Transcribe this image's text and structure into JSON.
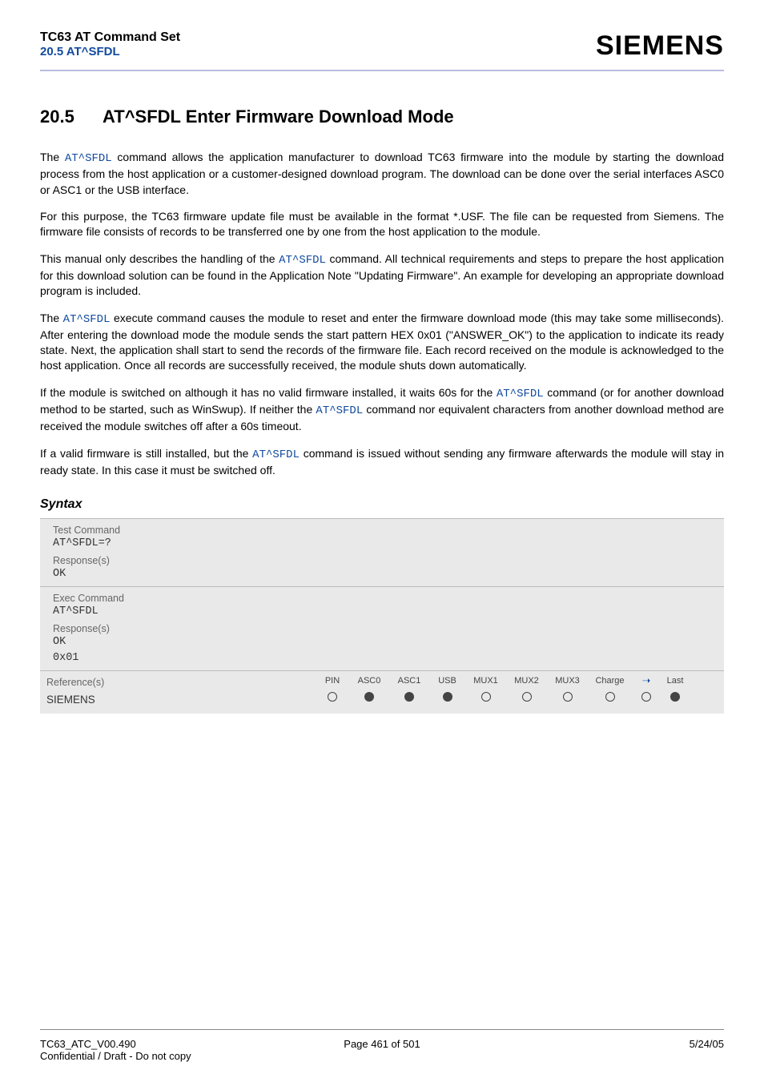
{
  "header": {
    "doc_title": "TC63 AT Command Set",
    "section_nav": "20.5 AT^SFDL",
    "brand": "SIEMENS"
  },
  "section": {
    "num": "20.5",
    "title": "AT^SFDL   Enter Firmware Download Mode"
  },
  "body": {
    "cmd": "AT^SFDL",
    "cmd_no_space": "AT^SFDL",
    "p1a": "The ",
    "p1b": " command allows the application manufacturer to download TC63 firmware into the module by starting the download process from the host application or a customer-designed download program. The download can be done over the serial interfaces ASC0 or ASC1 or the USB interface.",
    "p2": "For this purpose, the TC63 firmware update file must be available in the format *.USF. The file can be requested from Siemens. The firmware file consists of records to be transferred one by one from the host application to the module.",
    "p3a": "This manual only describes the handling of the ",
    "p3b": " command. All technical requirements and steps to prepare the host application for this download solution can be found in the Application Note \"Updating Firmware\". An example for developing an appropriate download program is included.",
    "p4a": "The ",
    "p4b": " execute command causes the module to reset and enter the firmware download mode (this may take some milliseconds). After entering the download mode the module sends the start pattern HEX 0x01 (\"ANSWER_OK\") to the application to indicate its ready state. Next, the application shall start to send the records of the firmware file. Each record received on the module is acknowledged to the host application. Once all records are successfully received, the module shuts down automatically.",
    "p5a": "If the module is switched on although it has no valid firmware installed, it waits 60s for the ",
    "p5b": " command (or for another download method to be started, such as WinSwup). If neither the ",
    "p5c": " command nor equivalent characters from another download method are received the module switches off after a 60s timeout.",
    "p6a": "If a valid firmware is still installed, but the ",
    "p6b": " command is issued without sending any firmware afterwards the module will stay in ready state. In this case it must be switched off."
  },
  "syntax": {
    "heading": "Syntax",
    "test_label": "Test Command",
    "test_cmd": "AT^SFDL=?",
    "resp_label": "Response(s)",
    "ok": "OK",
    "exec_label": "Exec Command",
    "exec_cmd": "AT^SFDL",
    "exec_resp1": "OK",
    "exec_resp2": "0x01",
    "ref_label": "Reference(s)",
    "ref_value": "SIEMENS",
    "cols": [
      "PIN",
      "ASC0",
      "ASC1",
      "USB",
      "MUX1",
      "MUX2",
      "MUX3",
      "Charge",
      "➝",
      "Last"
    ],
    "vals": [
      "open",
      "filled",
      "filled",
      "filled",
      "open",
      "open",
      "open",
      "open",
      "open",
      "filled"
    ]
  },
  "footer": {
    "left1": "TC63_ATC_V00.490",
    "left2": "Confidential / Draft - Do not copy",
    "center": "Page 461 of 501",
    "right": "5/24/05"
  }
}
